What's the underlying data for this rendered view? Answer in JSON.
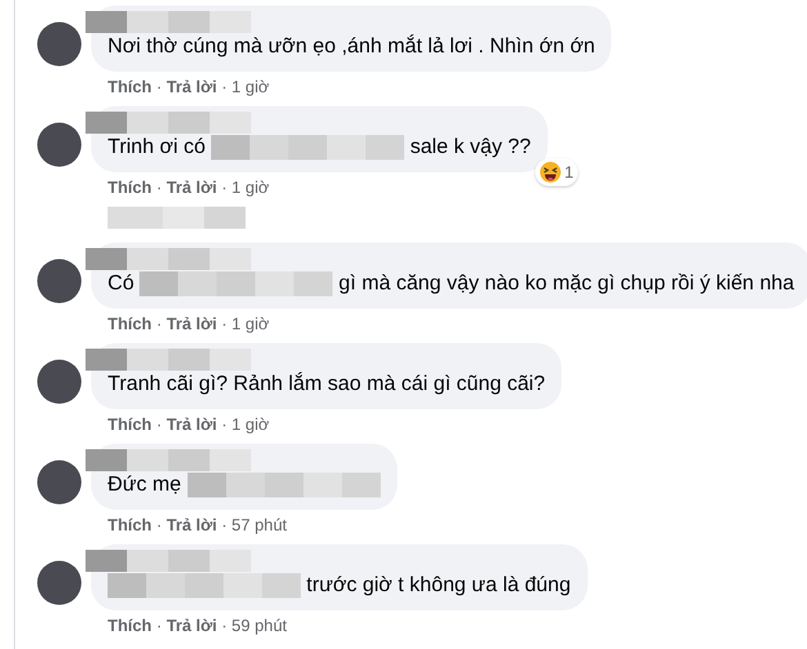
{
  "items": [
    {
      "kind": "comment",
      "parts": [
        {
          "kind": "text",
          "text": "Nơi thờ cúng mà ưỡn ẹo ,ánh mắt lả lơi . Nhìn ớn ớn"
        }
      ],
      "actions": [
        {
          "kind": "like",
          "text": "Thích"
        },
        {
          "kind": "sep",
          "text": "·"
        },
        {
          "kind": "reply",
          "text": "Trả lời"
        },
        {
          "kind": "sep",
          "text": "·"
        },
        {
          "kind": "time",
          "text": "1 giờ"
        }
      ]
    },
    {
      "kind": "comment",
      "parts": [
        {
          "kind": "text",
          "text": "Trinh ơi có"
        },
        {
          "kind": "redacted"
        },
        {
          "kind": "text",
          "text": "sale k vậy ??"
        }
      ],
      "actions": [
        {
          "kind": "like",
          "text": "Thích"
        },
        {
          "kind": "sep",
          "text": "·"
        },
        {
          "kind": "reply",
          "text": "Trả lời"
        },
        {
          "kind": "sep",
          "text": "·"
        },
        {
          "kind": "time",
          "text": "1 giờ"
        }
      ],
      "reaction": {
        "count": "1"
      }
    },
    {
      "kind": "replies_link"
    },
    {
      "kind": "comment",
      "parts": [
        {
          "kind": "text",
          "text": "Có"
        },
        {
          "kind": "redacted"
        },
        {
          "kind": "text",
          "text": "gì mà căng vậy nào ko mặc gì chụp rồi ý kiến nha"
        }
      ],
      "actions": [
        {
          "kind": "like",
          "text": "Thích"
        },
        {
          "kind": "sep",
          "text": "·"
        },
        {
          "kind": "reply",
          "text": "Trả lời"
        },
        {
          "kind": "sep",
          "text": "·"
        },
        {
          "kind": "time",
          "text": "1 giờ"
        }
      ]
    },
    {
      "kind": "comment",
      "parts": [
        {
          "kind": "text",
          "text": "Tranh cãi gì? Rảnh lắm sao mà cái gì cũng cãi?"
        }
      ],
      "actions": [
        {
          "kind": "like",
          "text": "Thích"
        },
        {
          "kind": "sep",
          "text": "·"
        },
        {
          "kind": "reply",
          "text": "Trả lời"
        },
        {
          "kind": "sep",
          "text": "·"
        },
        {
          "kind": "time",
          "text": "1 giờ"
        }
      ]
    },
    {
      "kind": "comment",
      "parts": [
        {
          "kind": "text",
          "text": "Đức mẹ"
        },
        {
          "kind": "redacted"
        }
      ],
      "actions": [
        {
          "kind": "like",
          "text": "Thích"
        },
        {
          "kind": "sep",
          "text": "·"
        },
        {
          "kind": "reply",
          "text": "Trả lời"
        },
        {
          "kind": "sep",
          "text": "·"
        },
        {
          "kind": "time",
          "text": "57 phút"
        }
      ]
    },
    {
      "kind": "comment",
      "parts": [
        {
          "kind": "redacted"
        },
        {
          "kind": "text",
          "text": "trước giờ t không ưa là đúng"
        }
      ],
      "actions": [
        {
          "kind": "like",
          "text": "Thích"
        },
        {
          "kind": "sep",
          "text": "·"
        },
        {
          "kind": "reply",
          "text": "Trả lời"
        },
        {
          "kind": "sep",
          "text": "·"
        },
        {
          "kind": "time",
          "text": "59 phút"
        }
      ]
    }
  ]
}
